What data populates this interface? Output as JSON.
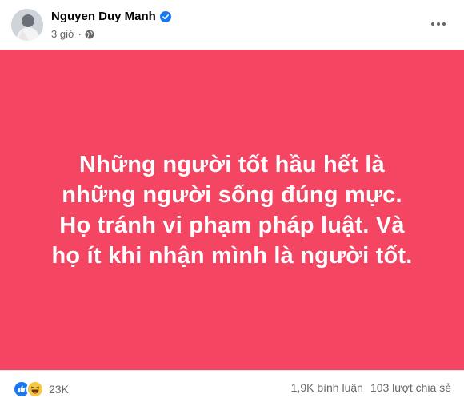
{
  "post": {
    "author_name": "Nguyen Duy Manh",
    "timestamp": "3 giờ",
    "background_color": "#f44563",
    "text": "Những người tốt hầu hết là những người sống đúng mực. Họ tránh vi phạm pháp luật. Và họ ít khi nhận mình là người tốt.",
    "icons": {
      "verified": "verified-badge-icon",
      "audience": "globe-icon",
      "more": "more-options-icon"
    }
  },
  "footer": {
    "reactions": [
      "like",
      "haha"
    ],
    "reaction_count": "23K",
    "comments": "1,9K bình luận",
    "shares": "103 lượt chia sẻ"
  }
}
